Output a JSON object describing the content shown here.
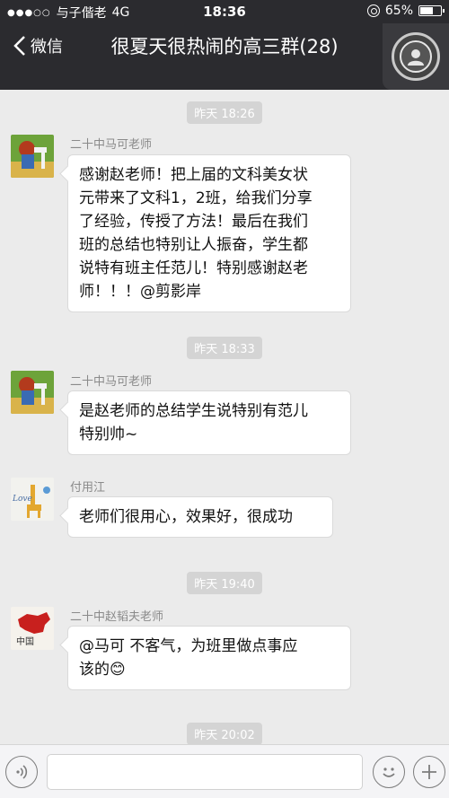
{
  "status_bar": {
    "carrier": "与子偕老",
    "network": "4G",
    "time": "18:36",
    "battery": "65%",
    "battery_level": 0.65
  },
  "nav": {
    "back_label": "微信",
    "title": "很夏天很热闹的高三群(28)"
  },
  "messages": [
    {
      "time": "昨天 18:26",
      "sender": "二十中马可老师",
      "lines": [
        "感谢赵老师！把上届的文科美女状",
        "元带来了文科1，2班，给我们分享",
        "了经验，传授了方法！最后在我们",
        "班的总结也特别让人振奋，学生都",
        "说特有班主任范儿！特别感谢赵老",
        "师！！！@剪影岸"
      ]
    },
    {
      "time": "昨天 18:33",
      "sender": "二十中马可老师",
      "lines": [
        "是赵老师的总结学生说特别有范儿",
        "特别帅~"
      ]
    },
    {
      "time": "",
      "sender": "付用江",
      "lines": [
        "老师们很用心，效果好，很成功"
      ]
    },
    {
      "time": "昨天 19:40",
      "sender": "二十中赵韬夫老师",
      "lines": [
        "@马可  不客气，为班里做点事应",
        "该的😊"
      ]
    }
  ],
  "trailing_time": "昨天 20:02",
  "avatar_text": {
    "love": "Love",
    "china": "中国"
  },
  "colors": {
    "header_bg": "#2b2b2f",
    "chat_bg": "#ebebeb",
    "bubble_bg": "#ffffff",
    "timestamp_bg": "#d4d4d4"
  }
}
